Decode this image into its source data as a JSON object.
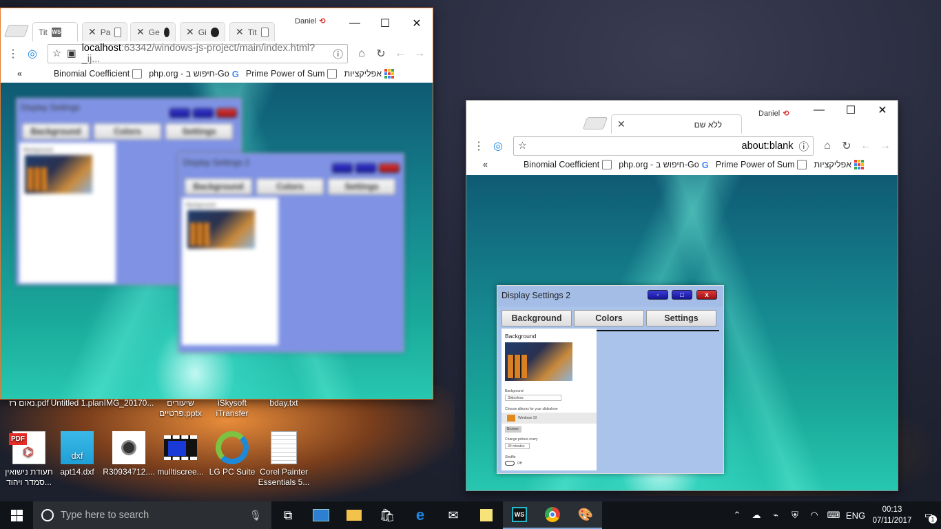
{
  "window1": {
    "tabs": [
      {
        "title": "Tit",
        "icon": "ws-icon"
      },
      {
        "title": "Pa",
        "icon": "doc-icon"
      },
      {
        "title": "Ge",
        "icon": "github-icon"
      },
      {
        "title": "Gi",
        "icon": "github-icon"
      },
      {
        "title": "Tit",
        "icon": "doc-icon"
      }
    ],
    "user": "Daniel",
    "url_host": "localhost",
    "url_path": ":63342/windows-js-project/main/index.html?_ij...",
    "bookmarks": [
      "Binomial Coefficient",
      "php.org - חיפוש ב-Go",
      "Prime Power of Sum",
      "אפליקציות"
    ],
    "overflow": "«",
    "blurred_window": {
      "title": "Display Settings",
      "tabs": [
        "Background",
        "Colors",
        "Settings"
      ],
      "heading": "Background"
    },
    "blurred_window2": {
      "title": "Display Settings 2",
      "tabs": [
        "Background",
        "Colors",
        "Settings"
      ],
      "heading": "Background"
    }
  },
  "window2": {
    "tab_title": "ללא שם",
    "user": "Daniel",
    "url": "about:blank",
    "bookmarks": [
      "Binomial Coefficient",
      "php.org - חיפוש ב-Go",
      "Prime Power of Sum",
      "אפליקציות"
    ],
    "overflow": "«",
    "display_settings": {
      "title": "Display Settings 2",
      "min": "-",
      "max": "□",
      "close": "x",
      "tabs": [
        "Background",
        "Colors",
        "Settings"
      ],
      "heading": "Background",
      "bg_label": "Background",
      "bg_value": "Slideshow",
      "albums_label": "Choose albums for your slideshow",
      "album": "Windows 10",
      "browse": "Browse",
      "change_label": "Change picture every",
      "change_value": "30 minutes",
      "shuffle_label": "Shuffle",
      "shuffle_value": "Off"
    }
  },
  "desktop": {
    "row1": [
      "נאום רז.pdf",
      "Untitled 1.plan",
      "IMG_20170...",
      "שיעורים פרטיים.pptx",
      "iSkysoft iTransfer",
      "bday.txt"
    ],
    "row2": [
      {
        "label": "תעודת נישואין סמדר ויהוד...",
        "icon": "pdf-icon",
        "badge": "PDF"
      },
      {
        "label": "apt14.dxf",
        "icon": "dxf-icon",
        "badge": "dxf"
      },
      {
        "label": "R30934712....",
        "icon": "watch-image-icon"
      },
      {
        "label": "mulltiscree...",
        "icon": "video-icon"
      },
      {
        "label": "LG PC Suite",
        "icon": "lg-suite-icon"
      },
      {
        "label": "Corel Painter Essentials 5...",
        "icon": "text-file-icon"
      }
    ]
  },
  "taskbar": {
    "search_placeholder": "Type here to search",
    "language": "ENG",
    "time": "00:13",
    "date": "07/11/2017",
    "notifications": "1"
  },
  "colors": {
    "accent_border": "#e27a2f",
    "chrome_blue": "#4285f4",
    "ds_panel": "#7f92e4"
  }
}
